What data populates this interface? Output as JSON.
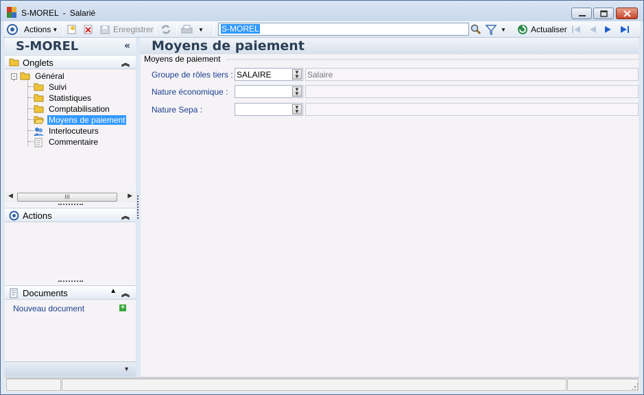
{
  "window": {
    "record_name": "S-MOREL",
    "separator": "-",
    "entity": "Salarié"
  },
  "toolbar": {
    "actions_label": "Actions",
    "save_label": "Enregistrer",
    "search_value": "S-MOREL",
    "refresh_label": "Actualiser"
  },
  "left_panel": {
    "title": "S-MOREL",
    "collapse_glyph": "«",
    "tabs_header": "Onglets",
    "tree": {
      "root": "Général",
      "items": [
        "Suivi",
        "Statistiques",
        "Comptabilisation",
        "Moyens de paiement",
        "Interlocuteurs",
        "Commentaire"
      ],
      "selected": "Moyens de paiement"
    },
    "scroll_thumb_glyph": "III",
    "actions_header": "Actions",
    "documents_header": "Documents",
    "new_document_link": "Nouveau document"
  },
  "main": {
    "title": "Moyens de paiement",
    "group_label": "Moyens de paiement",
    "fields": [
      {
        "label": "Groupe de rôles tiers :",
        "value": "SALAIRE",
        "description": "Salaire"
      },
      {
        "label": "Nature économique :",
        "value": "",
        "description": ""
      },
      {
        "label": "Nature Sepa :",
        "value": "",
        "description": ""
      }
    ]
  },
  "colors": {
    "accent_selection": "#3399ff",
    "panel_title": "#2c3e55",
    "link": "#1c3f8f"
  }
}
